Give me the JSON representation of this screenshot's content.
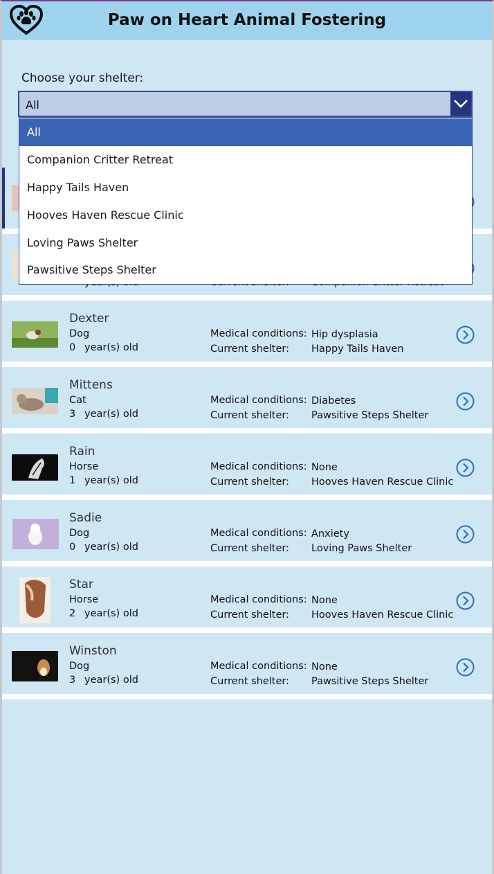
{
  "app": {
    "title": "Paw on Heart Animal Fostering",
    "logo_icon": "heart-paw-icon"
  },
  "filter": {
    "label": "Choose your shelter:",
    "selected": "All",
    "options": [
      "All",
      "Companion Critter Retreat",
      "Happy Tails Haven",
      "Hooves Haven Rescue Clinic",
      "Loving Paws Shelter",
      "Pawsitive Steps Shelter"
    ]
  },
  "labels": {
    "medical": "Medical conditions:",
    "shelter": "Current shelter:",
    "age_suffix": "year(s) old"
  },
  "pets": [
    {
      "name": "",
      "type": "",
      "age": "",
      "medical": "",
      "shelter": "",
      "thumb_color": "#e8c4b8"
    },
    {
      "name": "",
      "type": "",
      "age": "",
      "medical": "",
      "shelter": "Companion Critter Retreat",
      "thumb_color": "#efe2d0"
    },
    {
      "name": "Dexter",
      "type": "Dog",
      "age": "0",
      "medical": "Hip dysplasia",
      "shelter": "Happy Tails Haven",
      "thumb_color": "#6f9a4a"
    },
    {
      "name": "Mittens",
      "type": "Cat",
      "age": "3",
      "medical": "Diabetes",
      "shelter": "Pawsitive Steps Shelter",
      "thumb_color": "#b9a896"
    },
    {
      "name": "Rain",
      "type": "Horse",
      "age": "1",
      "medical": "None",
      "shelter": "Hooves Haven Rescue Clinic",
      "thumb_color": "#141414"
    },
    {
      "name": "Sadie",
      "type": "Dog",
      "age": "0",
      "medical": "Anxiety",
      "shelter": "Loving Paws Shelter",
      "thumb_color": "#c9b6dd"
    },
    {
      "name": "Star",
      "type": "Horse",
      "age": "2",
      "medical": "None",
      "shelter": "Hooves Haven Rescue Clinic",
      "thumb_color": "#9b5a3a"
    },
    {
      "name": "Winston",
      "type": "Dog",
      "age": "3",
      "medical": "None",
      "shelter": "Pawsitive Steps Shelter",
      "thumb_color": "#1e1a18"
    }
  ],
  "colors": {
    "header": "#9dd3ec",
    "background": "#cfe6f3",
    "accent": "#22357e",
    "highlight": "#3a64b4",
    "arrow": "#2a6fc0"
  },
  "icons": {
    "dropdown": "chevron-down-icon",
    "row_action": "chevron-right-circle-icon"
  }
}
